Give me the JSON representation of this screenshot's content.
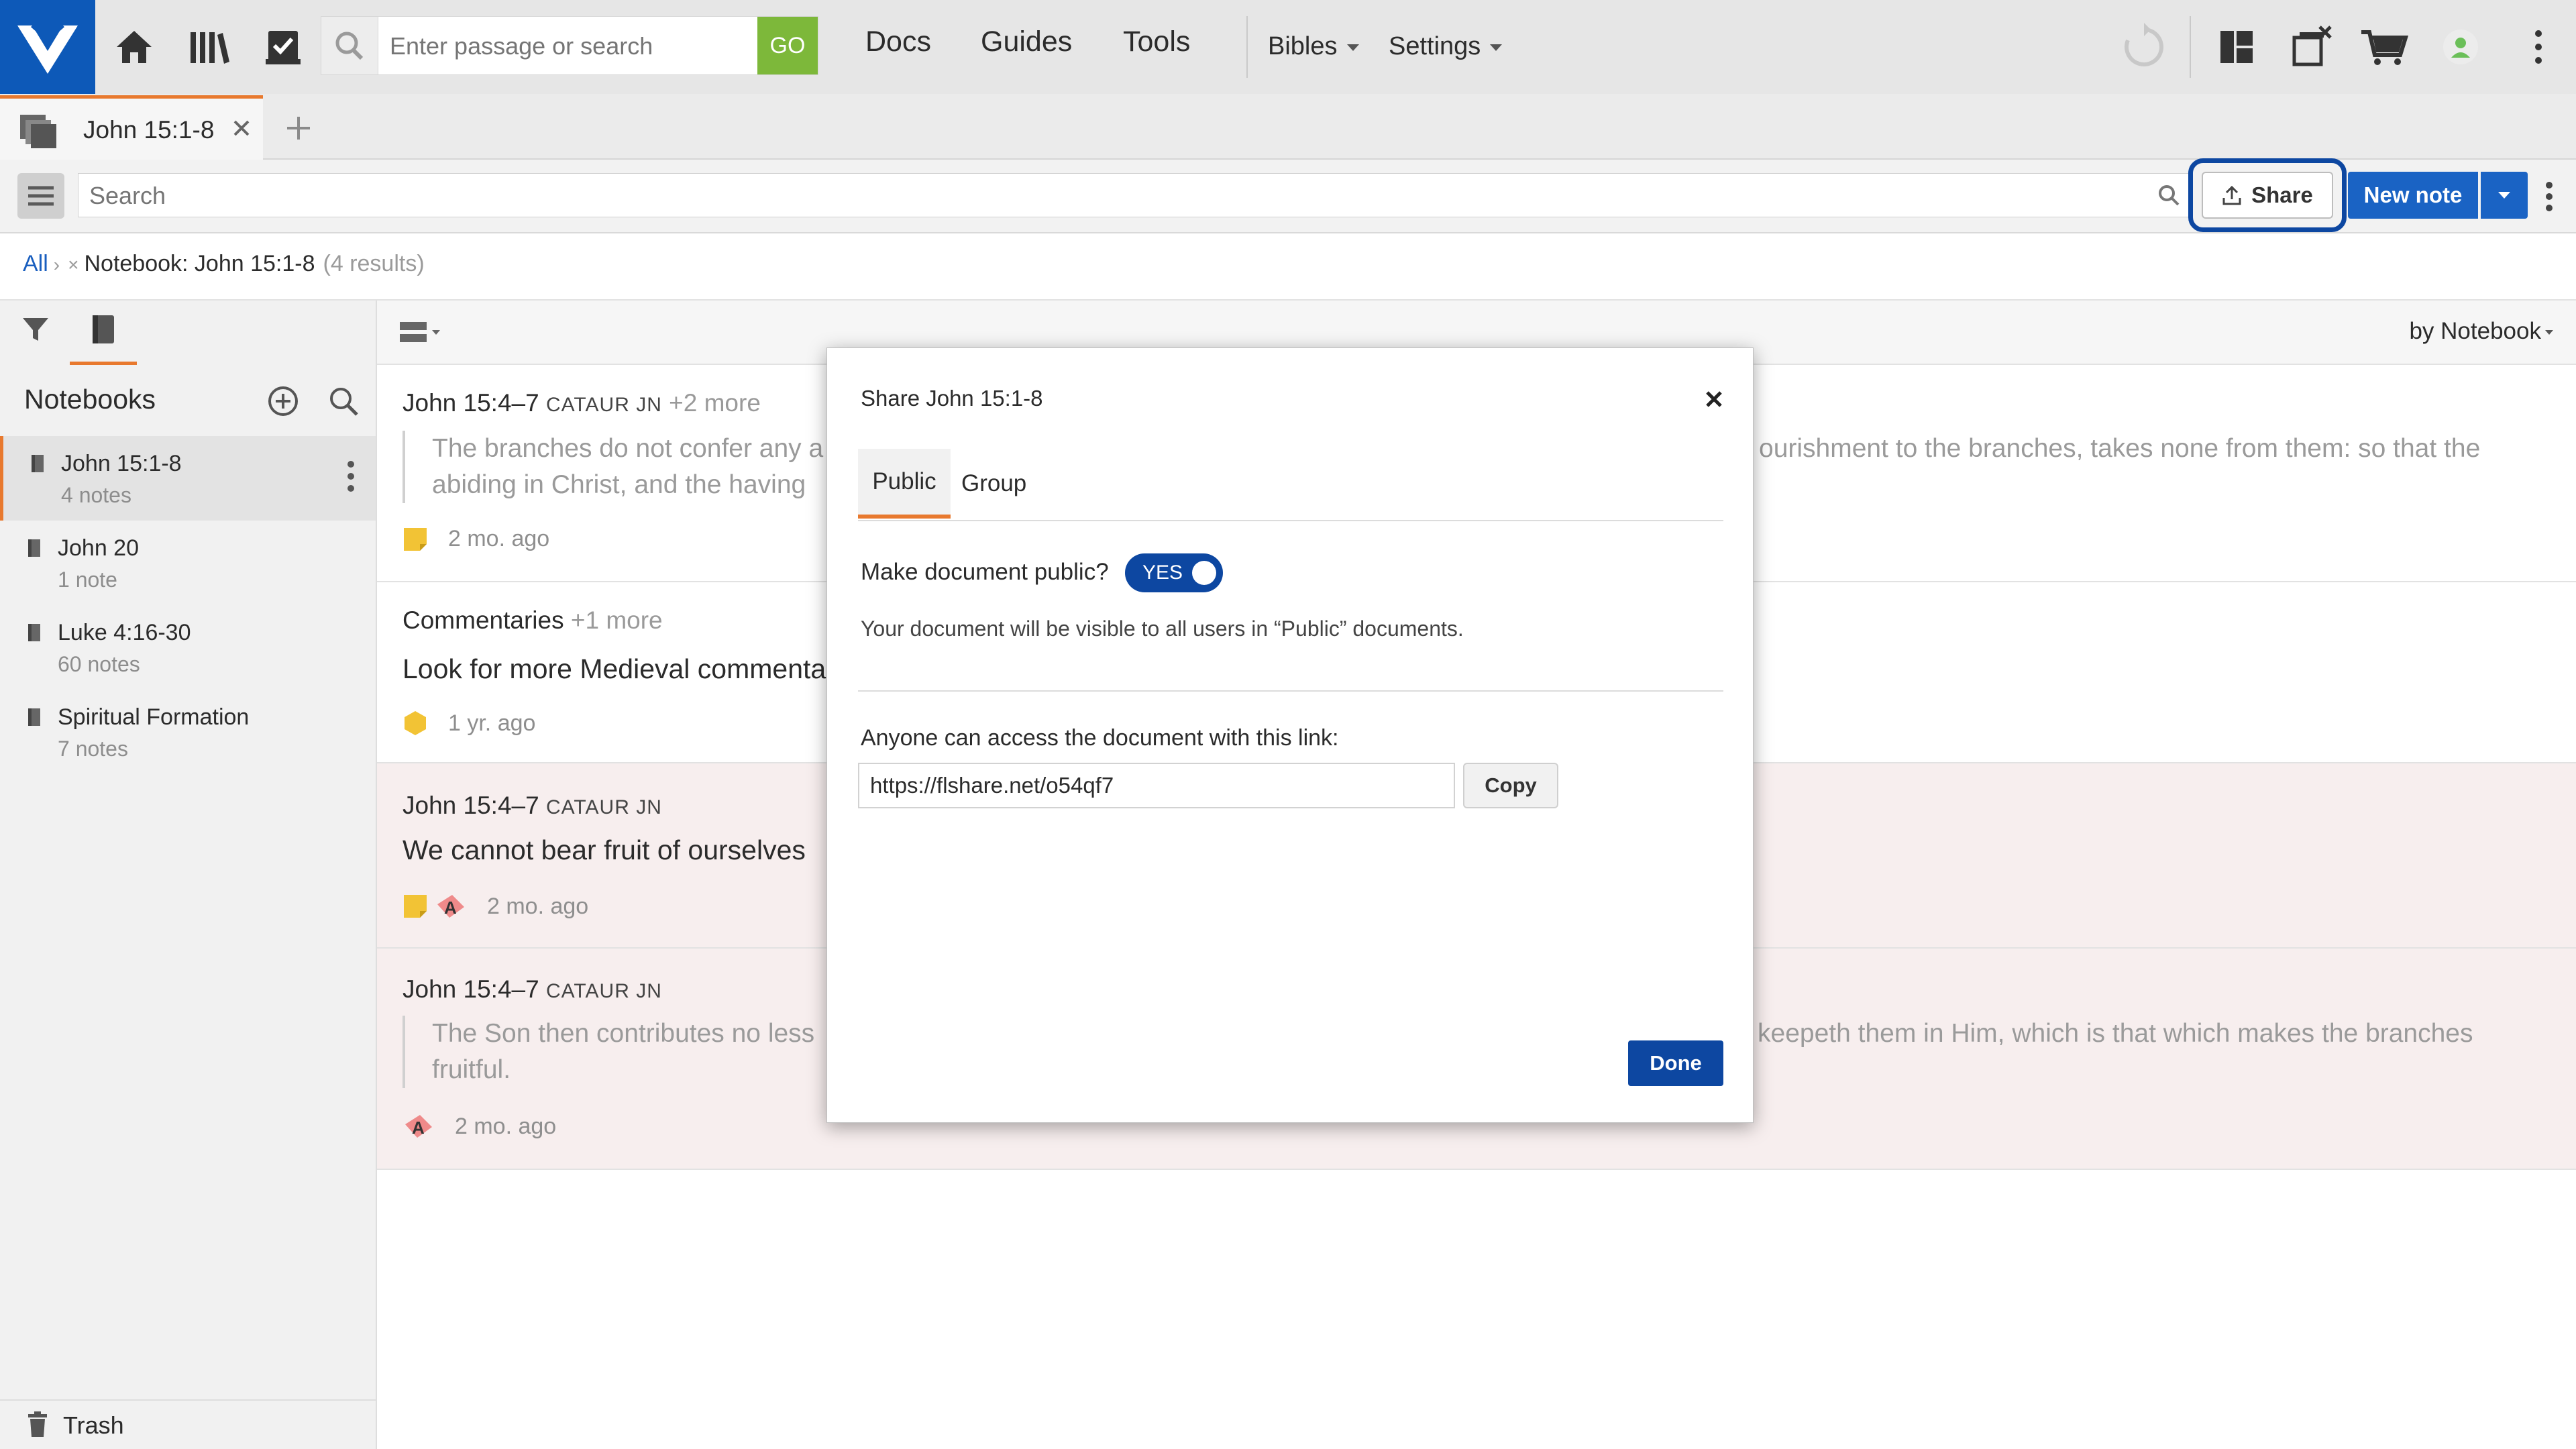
{
  "topbar": {
    "search_placeholder": "Enter passage or search",
    "go_label": "GO",
    "nav": [
      "Docs",
      "Guides",
      "Tools"
    ],
    "bibles_label": "Bibles",
    "settings_label": "Settings"
  },
  "tabs": {
    "active_label": "John 15:1-8"
  },
  "toolbar": {
    "search_placeholder": "Search",
    "share_label": "Share",
    "new_note_label": "New note"
  },
  "breadcrumb": {
    "all_label": "All",
    "separator": "›",
    "remove_symbol": "×",
    "filter_label": "Notebook: John 15:1-8",
    "results": "(4 results)"
  },
  "sidebar": {
    "heading": "Notebooks",
    "notebooks": [
      {
        "name": "John 15:1-8",
        "count": "4 notes"
      },
      {
        "name": "John 20",
        "count": "1 note"
      },
      {
        "name": "Luke 4:16-30",
        "count": "60 notes"
      },
      {
        "name": "Spiritual Formation",
        "count": "7 notes"
      }
    ],
    "trash_label": "Trash"
  },
  "list": {
    "sort_label": "by Notebook"
  },
  "notes": [
    {
      "ref": "John 15:4–7",
      "ref_abbr": "CATAUR JN",
      "more": "+2 more",
      "quote_left": "The branches do not confer any a",
      "quote_left_2": "abiding in Christ, and the having",
      "quote_right": "ourishment to the branches, takes none from them: so that the",
      "time": "2 mo. ago"
    },
    {
      "ref": "Commentaries",
      "more": "+1 more",
      "title": "Look for more Medieval commentar",
      "time": "1 yr. ago"
    },
    {
      "ref": "John 15:4–7",
      "ref_abbr": "CATAUR JN",
      "title": "We cannot bear fruit of ourselves",
      "time": "2 mo. ago"
    },
    {
      "ref": "John 15:4–7",
      "ref_abbr": "CATAUR JN",
      "quote_left": "The Son then contributes no less",
      "quote_left_2": "fruitful.",
      "quote_right": "keepeth them in Him, which is that which makes the branches",
      "time": "2 mo. ago"
    }
  ],
  "dialog": {
    "title": "Share John 15:1-8",
    "tab_public": "Public",
    "tab_group": "Group",
    "public_question": "Make document public?",
    "toggle_label": "YES",
    "visibility_note": "Your document will be visible to all users in “Public” documents.",
    "link_label": "Anyone can access the document with this link:",
    "link_value": "https://flshare.net/o54qf7",
    "copy_label": "Copy",
    "done_label": "Done"
  },
  "colors": {
    "brand_blue": "#0d59b8",
    "primary_button": "#1a63c4",
    "dark_blue": "#0d47a1",
    "accent_orange": "#e8792e",
    "go_green": "#7db83a",
    "highlight_row": "#f7eeee"
  }
}
